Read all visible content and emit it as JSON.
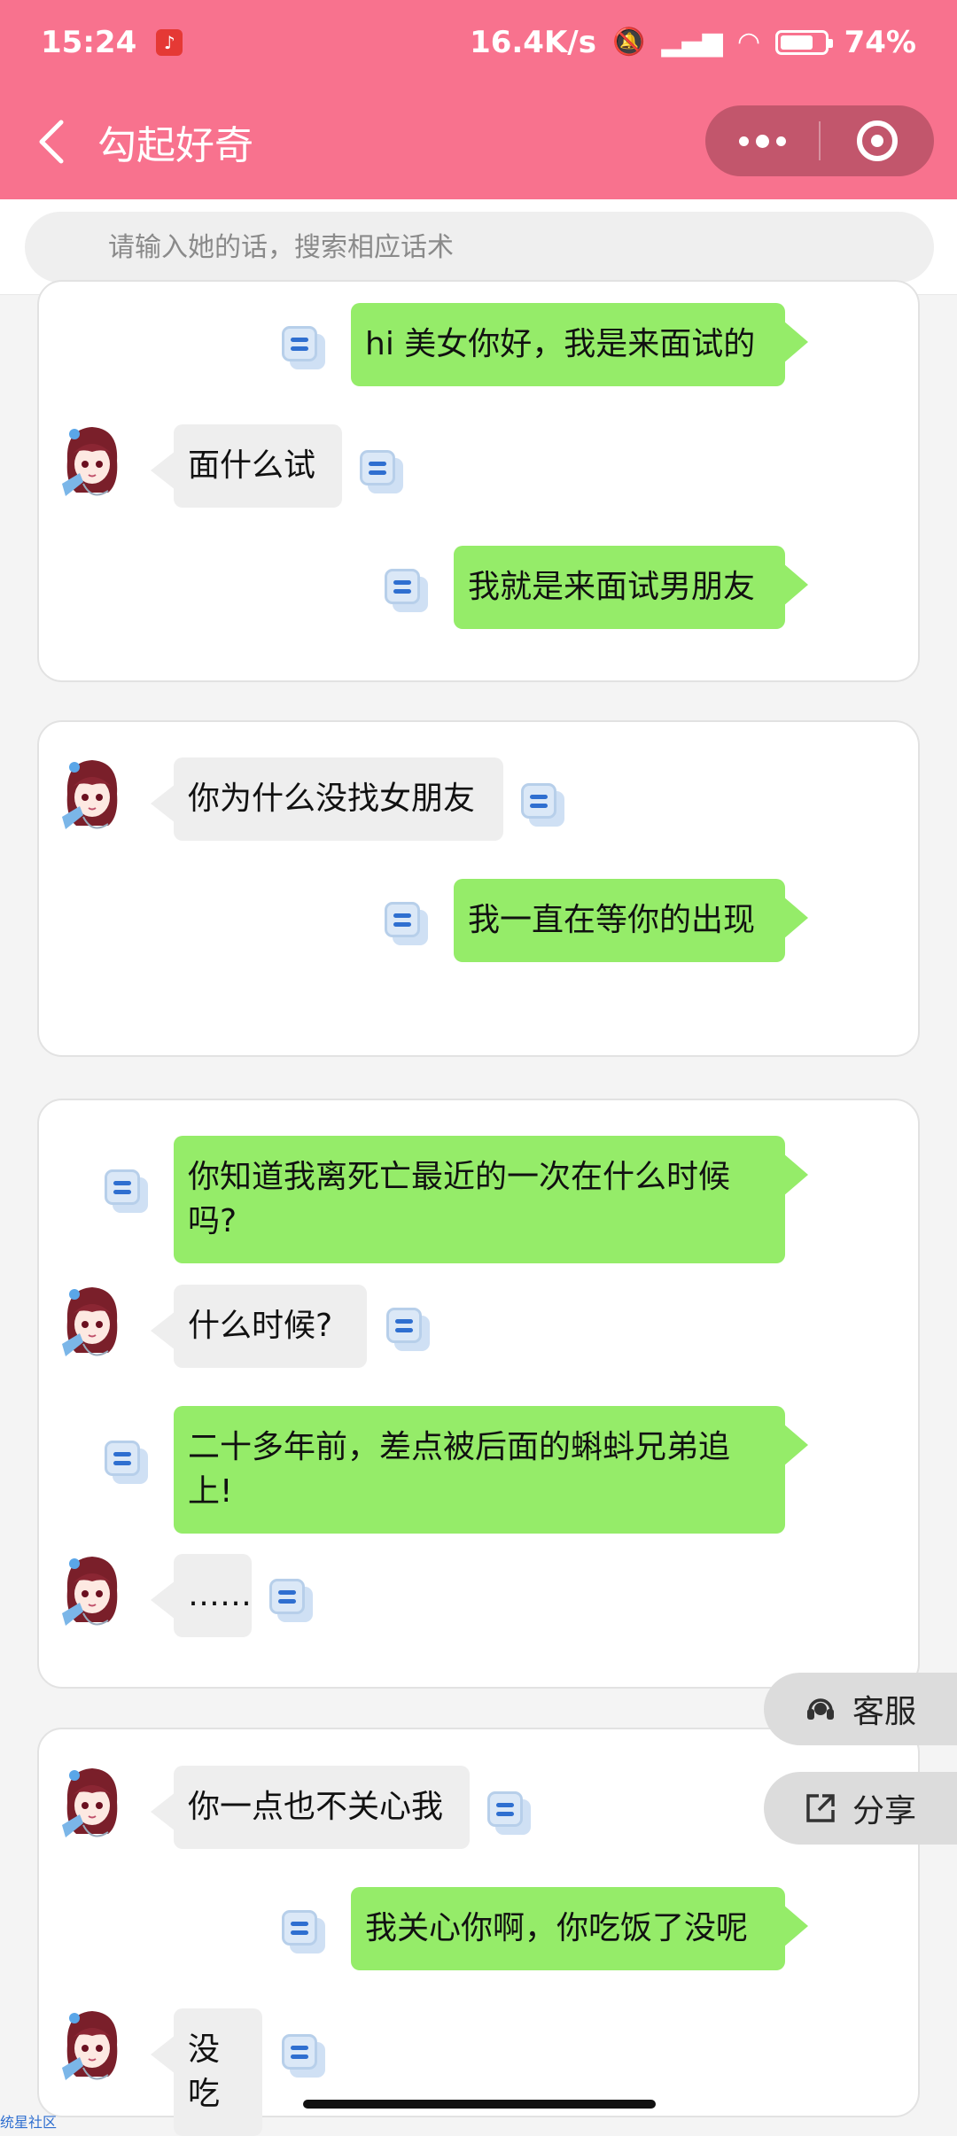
{
  "status": {
    "time": "15:24",
    "speed": "16.4K/s",
    "battery": "74%",
    "battery_level": 0.74
  },
  "nav": {
    "title": "勾起好奇"
  },
  "search": {
    "placeholder": "请输入她的话，搜索相应话术"
  },
  "cards": [
    {
      "messages": [
        {
          "side": "right",
          "text": "hi 美女你好，我是来面试的"
        },
        {
          "side": "left",
          "text": "面什么试"
        },
        {
          "side": "right",
          "text": "我就是来面试男朋友"
        }
      ]
    },
    {
      "messages": [
        {
          "side": "left",
          "text": "你为什么没找女朋友"
        },
        {
          "side": "right",
          "text": "我一直在等你的出现"
        }
      ]
    },
    {
      "messages": [
        {
          "side": "right",
          "text": "你知道我离死亡最近的一次在什么时候吗?"
        },
        {
          "side": "left",
          "text": "什么时候?"
        },
        {
          "side": "right",
          "text": "二十多年前，差点被后面的蝌蚪兄弟追上!"
        },
        {
          "side": "left",
          "text": "……"
        }
      ]
    },
    {
      "messages": [
        {
          "side": "left",
          "text": "你一点也不关心我"
        },
        {
          "side": "right",
          "text": "我关心你啊，你吃饭了没呢"
        },
        {
          "side": "left",
          "text": "没吃"
        }
      ]
    }
  ],
  "side_buttons": {
    "service": "客服",
    "share": "分享"
  },
  "watermark": "统星社区",
  "colors": {
    "header": "#f8728e",
    "bubble_green": "#95ec69",
    "bubble_gray": "#eeeeee"
  }
}
